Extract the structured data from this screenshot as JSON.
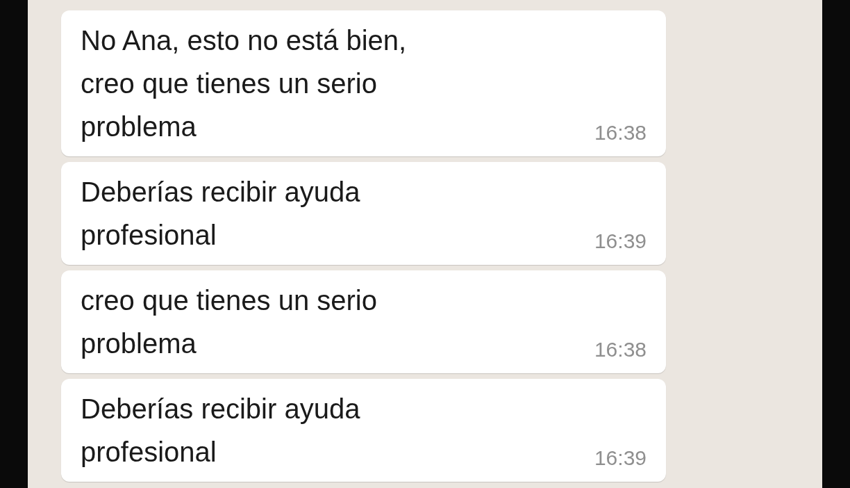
{
  "messages": [
    {
      "text": "No Ana, esto no está bien,\ncreo que tienes un serio\nproblema",
      "time": "16:38"
    },
    {
      "text": "Deberías recibir ayuda\nprofesional",
      "time": "16:39"
    },
    {
      "text": "creo que tienes un serio\nproblema",
      "time": "16:38"
    },
    {
      "text": "Deberías recibir ayuda\nprofesional",
      "time": "16:39"
    }
  ]
}
